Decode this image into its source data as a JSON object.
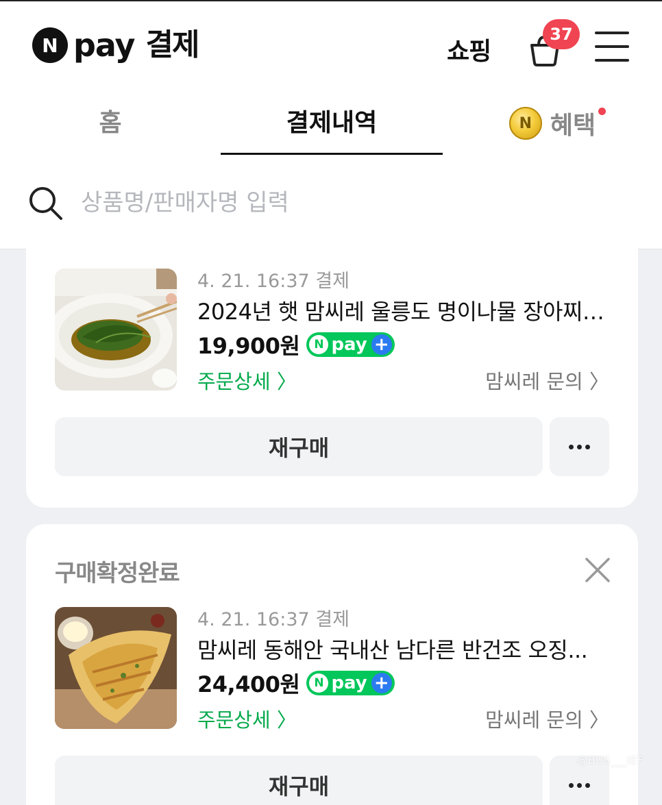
{
  "header": {
    "logo_badge": "N",
    "logo_pay": "pay",
    "logo_title": "결제",
    "shopping_label": "쇼핑",
    "cart_count": "37",
    "cart_icon": "shopping-bag-icon",
    "menu_icon": "hamburger-menu-icon"
  },
  "tabs": {
    "home": "홈",
    "history": "결제내역",
    "benefit": "혜택",
    "benefit_coin": "N",
    "active": "history"
  },
  "search": {
    "placeholder": "상품명/판매자명 입력",
    "value": "",
    "icon": "search-icon"
  },
  "orders": [
    {
      "status": "",
      "date": "4. 21. 16:37 결제",
      "title": "2024년 햇 맘씨레 울릉도 명이나물 장아찌 ...",
      "price": "19,900원",
      "pay_badge_n": "N",
      "pay_badge_text": "pay",
      "pay_badge_plus": "+",
      "detail_link": "주문상세 〉",
      "seller_link": "맘씨레 문의 〉",
      "rebuy_label": "재구매"
    },
    {
      "status": "구매확정완료",
      "date": "4. 21. 16:37 결제",
      "title": "맘씨레 동해안 국내산 남다른 반건조 오징...",
      "price": "24,400원",
      "pay_badge_n": "N",
      "pay_badge_text": "pay",
      "pay_badge_plus": "+",
      "detail_link": "주문상세 〉",
      "seller_link": "맘씨레 문의 〉",
      "rebuy_label": "재구매"
    }
  ],
  "watermark": "@BUS___IEF",
  "colors": {
    "npay_green": "#03c75a",
    "badge_red": "#f04452",
    "link_green": "#03a94a",
    "background": "#eef0f4"
  }
}
